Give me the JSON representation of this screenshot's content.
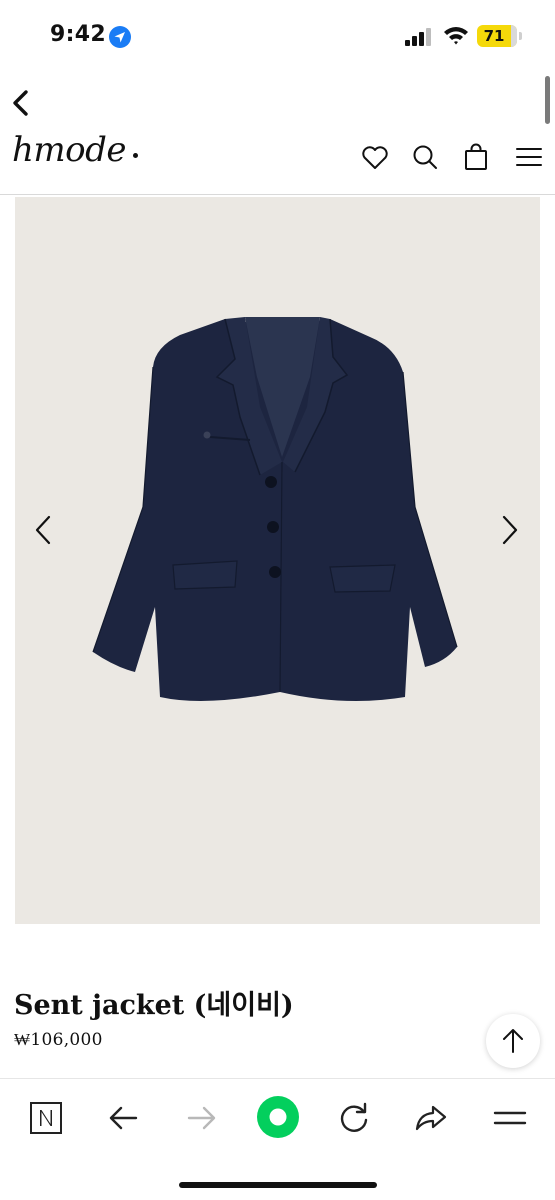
{
  "status_bar": {
    "time": "9:42",
    "battery_level": "71",
    "icons": [
      "location-arrow-icon",
      "signal-icon",
      "wifi-icon",
      "battery-icon"
    ],
    "battery_color": "#f5d90a"
  },
  "header": {
    "logo": "hmode",
    "icons": [
      "chevron-left-icon",
      "heart-icon",
      "search-icon",
      "shopping-bag-icon",
      "menu-icon"
    ]
  },
  "product": {
    "name": "Sent jacket (네이비)",
    "price": "₩106,000",
    "image_background": "#ebe8e3",
    "jacket_color": "#1d2540"
  },
  "browser_toolbar": {
    "icons": [
      "naver-n-icon",
      "back-arrow-icon",
      "forward-arrow-icon",
      "green-home-icon",
      "reload-icon",
      "share-icon",
      "menu-icon"
    ],
    "accent_color": "#03cf5d"
  }
}
